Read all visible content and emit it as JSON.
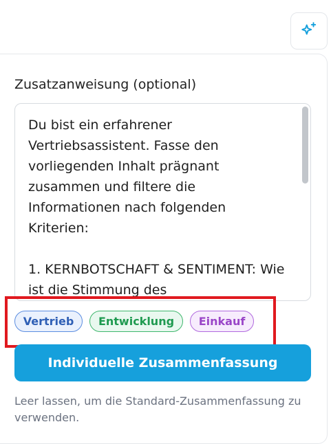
{
  "ai_button": {
    "icon": "sparkles-icon",
    "color": "#16a0dc"
  },
  "prompt": {
    "label": "Zusatzanweisung (optional)",
    "value": "Du bist ein erfahrener\nVertriebsassistent. Fasse den\nvorliegenden Inhalt prägnant\nzusammen und filtere die\nInformationen nach folgenden\nKriterien:\n\n1. KERNBOTSCHAFT & SENTIMENT: Wie\nist die Stimmung des"
  },
  "chips": [
    {
      "label": "Vertrieb",
      "color": "#2f5fb5"
    },
    {
      "label": "Entwicklung",
      "color": "#1f9a50"
    },
    {
      "label": "Einkauf",
      "color": "#9a46c8"
    }
  ],
  "primary_button": {
    "label": "Individuelle Zusammenfassung",
    "color": "#16a0dc"
  },
  "hint": "Leer lassen, um die Standard-Zusammenfassung zu verwenden.",
  "highlight_color": "#e0191f"
}
